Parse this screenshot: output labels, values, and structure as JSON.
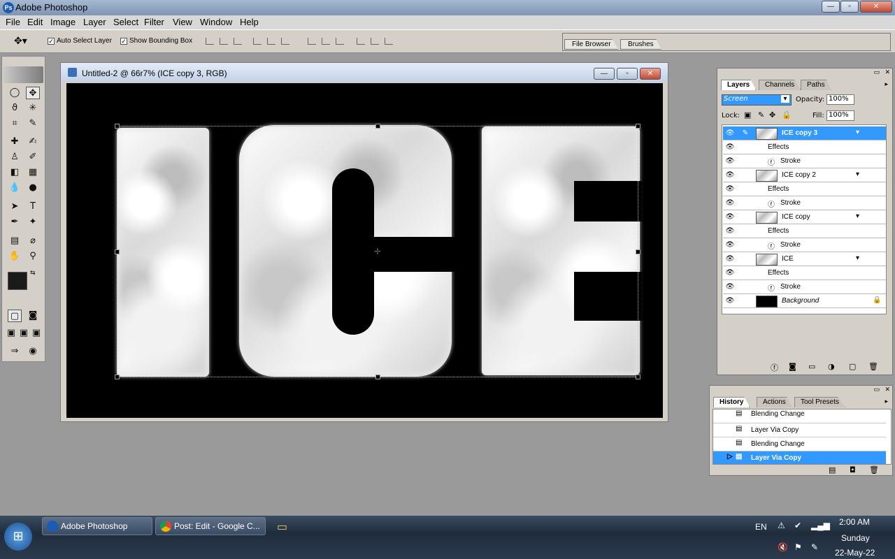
{
  "window": {
    "title": "Adobe Photoshop",
    "min": "—",
    "max": "▫",
    "close": "✕"
  },
  "menu": [
    "File",
    "Edit",
    "Image",
    "Layer",
    "Select",
    "Filter",
    "View",
    "Window",
    "Help"
  ],
  "options": {
    "auto_select": "Auto Select Layer",
    "bounding_box": "Show Bounding Box"
  },
  "well_tabs": [
    "File Browser",
    "Brushes"
  ],
  "document": {
    "title": "Untitled-2 @ 66r7% (ICE copy 3, RGB)"
  },
  "layers_panel": {
    "tabs": [
      "Layers",
      "Channels",
      "Paths"
    ],
    "blend_mode": "Screen",
    "opacity_label": "Opacity:",
    "opacity": "100%",
    "lock_label": "Lock:",
    "fill_label": "Fill:",
    "fill": "100%",
    "layers": [
      {
        "name": "ICE copy 3",
        "effects": "Effects",
        "stroke": "Stroke"
      },
      {
        "name": "ICE copy 2",
        "effects": "Effects",
        "stroke": "Stroke"
      },
      {
        "name": "ICE copy",
        "effects": "Effects",
        "stroke": "Stroke"
      },
      {
        "name": "ICE",
        "effects": "Effects",
        "stroke": "Stroke"
      }
    ],
    "background": "Background"
  },
  "history_panel": {
    "tabs": [
      "History",
      "Actions",
      "Tool Presets"
    ],
    "items": [
      "Blending Change",
      "Layer Via Copy",
      "Blending Change",
      "Layer Via Copy"
    ]
  },
  "taskbar": {
    "photoshop": "Adobe Photoshop",
    "chrome": "Post: Edit - Google C...",
    "lang": "EN",
    "time": "2:00 AM",
    "day": "Sunday",
    "date": "22-May-22"
  },
  "colors": {
    "accent": "#3399ff",
    "canvas": "#000000"
  }
}
